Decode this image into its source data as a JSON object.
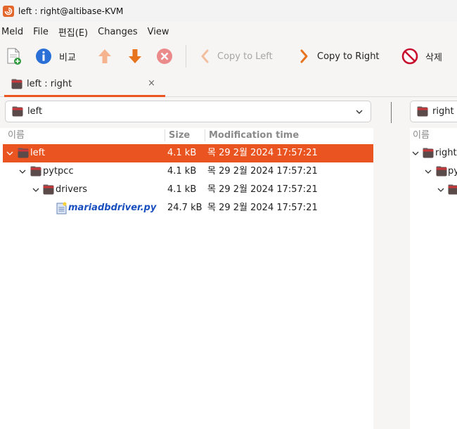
{
  "window": {
    "title": "left : right@altibase-KVM"
  },
  "menu": {
    "items": [
      "Meld",
      "File",
      "편집(E)",
      "Changes",
      "View"
    ]
  },
  "toolbar": {
    "compare_label": "비교",
    "copy_left_label": "Copy to Left",
    "copy_right_label": "Copy to Right",
    "delete_label": "삭제"
  },
  "tab": {
    "label": "left : right",
    "close": "×"
  },
  "paths": {
    "left": "left",
    "right": "right"
  },
  "columns": {
    "name": "이름",
    "size": "Size",
    "mtime": "Modification time"
  },
  "left_rows": [
    {
      "name": "left",
      "size": "4.1 kB",
      "mtime": "목 29  2월 2024 17:57:21",
      "type": "folder",
      "depth": 0,
      "selected": true
    },
    {
      "name": "pytpcc",
      "size": "4.1 kB",
      "mtime": "목 29  2월 2024 17:57:21",
      "type": "folder",
      "depth": 1,
      "selected": false
    },
    {
      "name": "drivers",
      "size": "4.1 kB",
      "mtime": "목 29  2월 2024 17:57:21",
      "type": "folder",
      "depth": 2,
      "selected": false
    },
    {
      "name": "mariadbdriver.py",
      "size": "24.7 kB",
      "mtime": "목 29  2월 2024 17:57:21",
      "type": "file",
      "depth": 3,
      "selected": false
    }
  ],
  "right_rows": [
    {
      "name": "right",
      "type": "folder",
      "depth": 0
    },
    {
      "name": "py",
      "type": "folder",
      "depth": 1
    },
    {
      "name": "",
      "type": "folder",
      "depth": 2
    }
  ],
  "colors": {
    "accent": "#e95420",
    "folder": "#5a4a4a",
    "file_name": "#1a4fbf"
  }
}
